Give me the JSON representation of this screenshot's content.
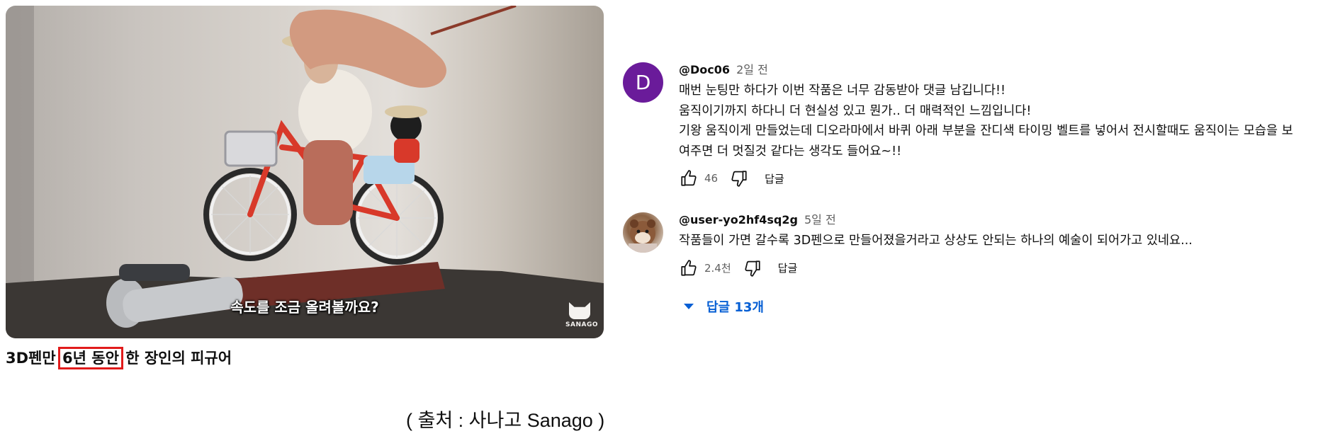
{
  "video": {
    "subtitle": "속도를 조금 올려볼까요?",
    "channel_logo_text": "SANAGO",
    "title_before": "3D펜만 ",
    "title_highlight": "6년 동안",
    "title_after": " 한 장인의 피규어"
  },
  "source_note": "( 출처 : 사나고 Sanago )",
  "comments": [
    {
      "avatar_letter": "D",
      "avatar_color": "#6a1b9a",
      "author": "@Doc06",
      "time": "2일 전",
      "text": "매번 눈팅만 하다가 이번 작품은 너무 감동받아 댓글 남깁니다!!\n움직이기까지 하다니 더 현실성 있고 뭔가.. 더 매력적인 느낌입니다!\n기왕 움직이게 만들었는데 디오라마에서 바퀴 아래 부분을 잔디색 타이밍 벨트를 넣어서 전시할때도 움직이는 모습을 보\n여주면 더 멋질것 같다는 생각도 들어요~!!",
      "likes": "46",
      "reply_label": "답글"
    },
    {
      "avatar_icon": "hamster-avatar-icon",
      "author": "@user-yo2hf4sq2g",
      "time": "5일 전",
      "text": "작품들이 가면 갈수록 3D펜으로 만들어졌을거라고 상상도 안되는 하나의 예술이 되어가고 있네요...",
      "likes": "2.4천",
      "reply_label": "답글"
    }
  ],
  "replies_toggle": "답글 13개",
  "colors": {
    "link_blue": "#065fd4",
    "highlight_box": "#e11b1b"
  }
}
